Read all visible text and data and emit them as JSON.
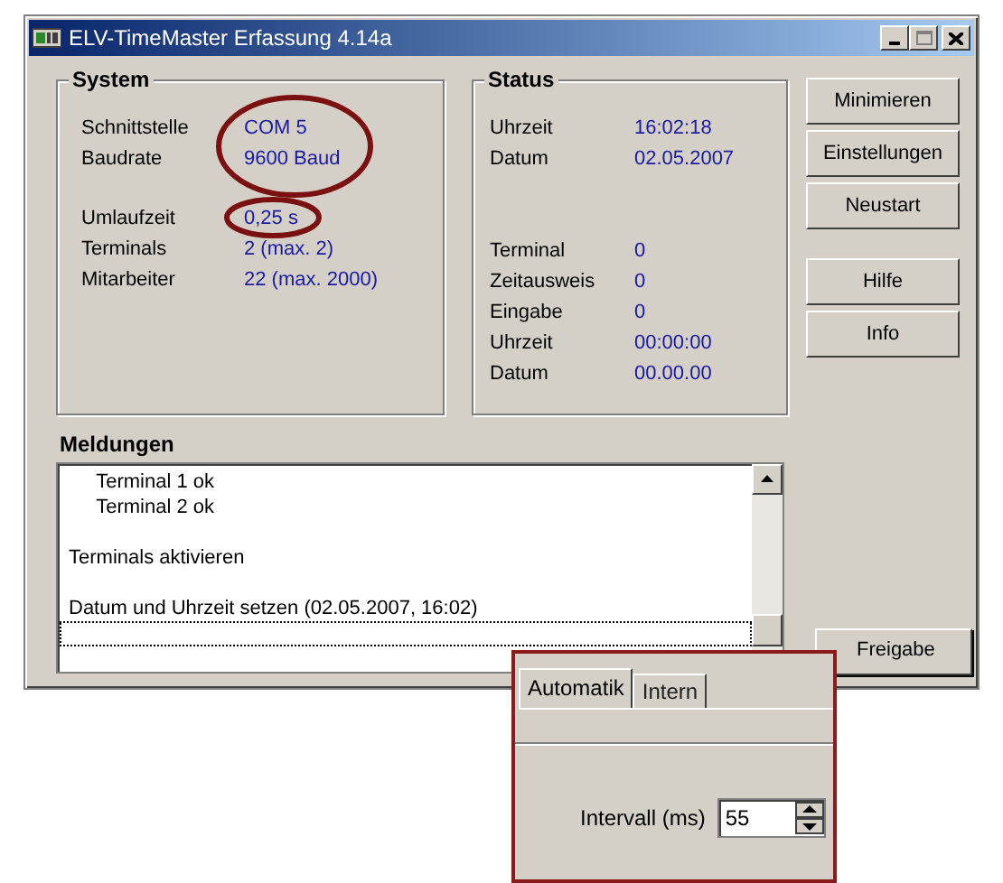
{
  "window": {
    "title": "ELV-TimeMaster Erfassung 4.14a"
  },
  "system": {
    "title": "System",
    "blocks": [
      [
        {
          "label": "Schnittstelle",
          "value": "COM 5"
        },
        {
          "label": "Baudrate",
          "value": "9600 Baud"
        }
      ],
      [
        {
          "label": "Umlaufzeit",
          "value": "0,25 s"
        },
        {
          "label": "Terminals",
          "value": "2 (max. 2)"
        },
        {
          "label": "Mitarbeiter",
          "value": "22 (max. 2000)"
        }
      ]
    ]
  },
  "status": {
    "title": "Status",
    "blocks": [
      [
        {
          "label": "Uhrzeit",
          "value": "16:02:18"
        },
        {
          "label": "Datum",
          "value": "02.05.2007"
        }
      ],
      [
        {
          "label": "Terminal",
          "value": "0"
        },
        {
          "label": "Zeitausweis",
          "value": "0"
        },
        {
          "label": "Eingabe",
          "value": "0"
        },
        {
          "label": "Uhrzeit",
          "value": "00:00:00"
        },
        {
          "label": "Datum",
          "value": "00.00.00"
        }
      ]
    ]
  },
  "buttons": [
    [
      "Minimieren",
      "Einstellungen",
      "Neustart"
    ],
    [
      "Hilfe",
      "Info"
    ]
  ],
  "messages": {
    "title": "Meldungen",
    "focus_row": true,
    "groups": [
      [
        "     Terminal 1 ok",
        "     Terminal 2 ok"
      ],
      [
        "Terminals aktivieren"
      ],
      [
        "Datum und Uhrzeit setzen (02.05.2007, 16:02)"
      ]
    ]
  },
  "release_button": "Freigabe",
  "inset": {
    "tabs": [
      {
        "label": "Automatik",
        "selected": true
      },
      {
        "label": "Intern",
        "selected": false
      }
    ],
    "field": {
      "label": "Intervall (ms)",
      "value": "55"
    }
  }
}
